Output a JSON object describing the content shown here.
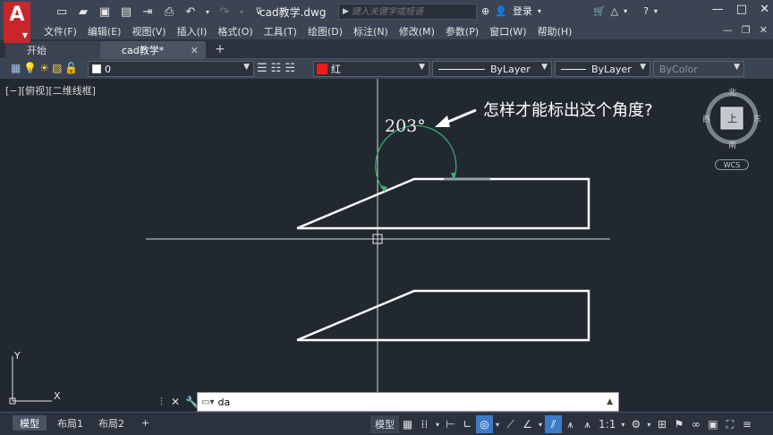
{
  "title_bar": {
    "document_title": "cad教学.dwg",
    "search_placeholder": "键入关键字或短语",
    "login_label": "登录",
    "quick_access_icons": [
      "new-icon",
      "open-icon",
      "save-icon",
      "saveas-icon",
      "export-icon",
      "print-icon",
      "undo-icon",
      "redo-icon"
    ]
  },
  "menu": {
    "items": [
      "文件(F)",
      "编辑(E)",
      "视图(V)",
      "插入(I)",
      "格式(O)",
      "工具(T)",
      "绘图(D)",
      "标注(N)",
      "修改(M)",
      "参数(P)",
      "窗口(W)",
      "帮助(H)"
    ]
  },
  "tabs": {
    "start_label": "开始",
    "active_label": "cad教学*",
    "add_label": "+"
  },
  "properties": {
    "layer": "0",
    "color": "红",
    "color_hex": "#ee1c1c",
    "linetype": "ByLayer",
    "lineweight": "ByLayer",
    "plotstyle": "ByColor"
  },
  "viewport": {
    "view_label": "[−][俯视][二维线框]",
    "dimension_text": "203°",
    "annotation_text": "怎样才能标出这个角度?",
    "accent_color": "#3cb371"
  },
  "navcube": {
    "north": "北",
    "south": "南",
    "east": "东",
    "west": "西",
    "top": "上",
    "wcs": "WCS"
  },
  "ucs": {
    "x_label": "X",
    "y_label": "Y"
  },
  "command": {
    "input_value": "da"
  },
  "status": {
    "layout_tabs": [
      "模型",
      "布局1",
      "布局2"
    ],
    "add_tab": "+",
    "model_label": "模型",
    "scale_label": "1:1"
  }
}
